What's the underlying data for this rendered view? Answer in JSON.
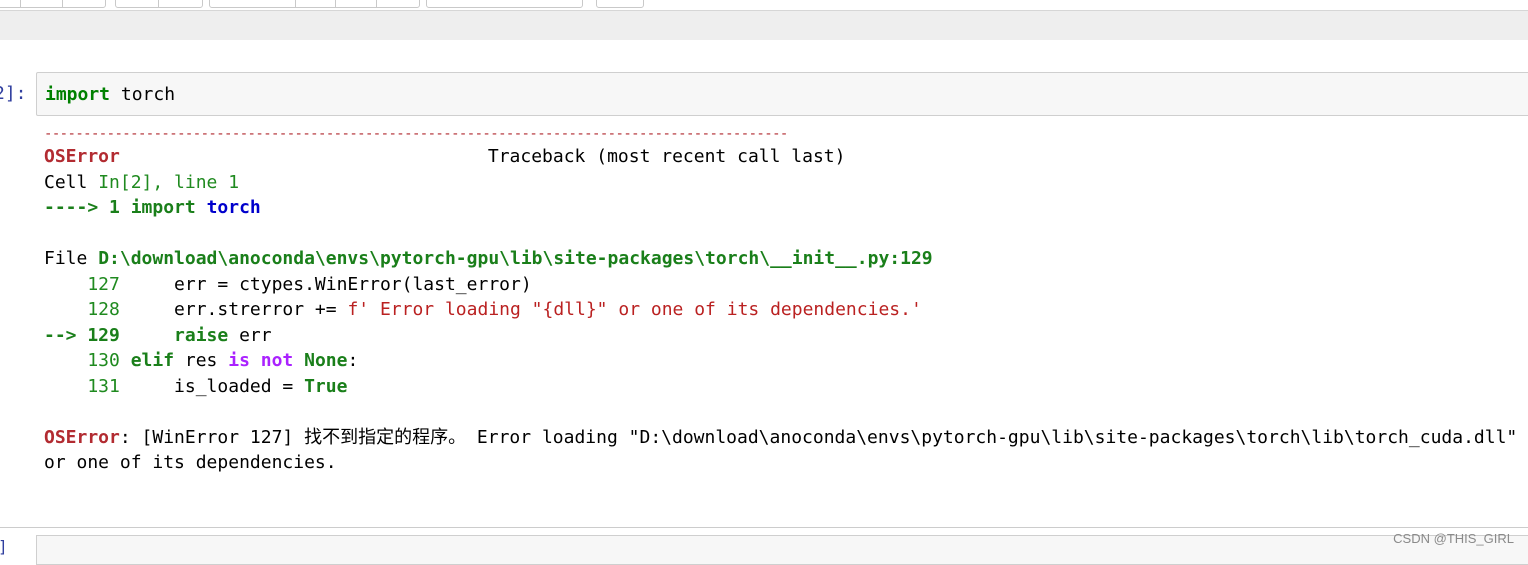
{
  "cell": {
    "prompt": "2]:",
    "input_keyword": "import",
    "input_rest": " torch"
  },
  "output": {
    "dashes": "-----------------------------------------------------------------------------------------------",
    "err_name": "OSError",
    "traceback_header": "Traceback (most recent call last)",
    "cell_word": "Cell ",
    "cell_ref": "In[2], line 1",
    "arrow1": "----> 1 ",
    "import_kw": "import",
    "torch_word": " torch",
    "file_word": "File ",
    "file_path": "D:\\download\\anoconda\\envs\\pytorch-gpu\\lib\\site-packages\\torch\\__init__.py:129",
    "l127_num": "    127",
    "l127_code": "     err = ctypes.WinError(last_error)",
    "l128_num": "    128",
    "l128_code": "     err.strerror += ",
    "l128_str": "f' Error loading \"{dll}\" or one of its dependencies.'",
    "arrow129": "--> 129",
    "l129_kw": "     raise",
    "l129_rest": " err",
    "l130_num": "    130",
    "l130_elif": " elif",
    "l130_res": " res ",
    "l130_is": "is",
    "l130_not": " not",
    "l130_none": " None",
    "l130_colon": ":",
    "l131_num": "    131",
    "l131_code": "     is_loaded = ",
    "l131_true": "True",
    "final_err_name": "OSError",
    "final_msg_1": ": [WinError 127] 找不到指定的程序。 Error loading \"D:\\download\\anoconda\\envs\\pytorch-gpu\\lib\\site-packages\\torch\\lib\\torch_cuda.dll\"",
    "final_msg_2": "or one of its dependencies."
  },
  "next_cell": {
    "prompt": "]"
  },
  "watermark": "CSDN @THIS_GIRL"
}
